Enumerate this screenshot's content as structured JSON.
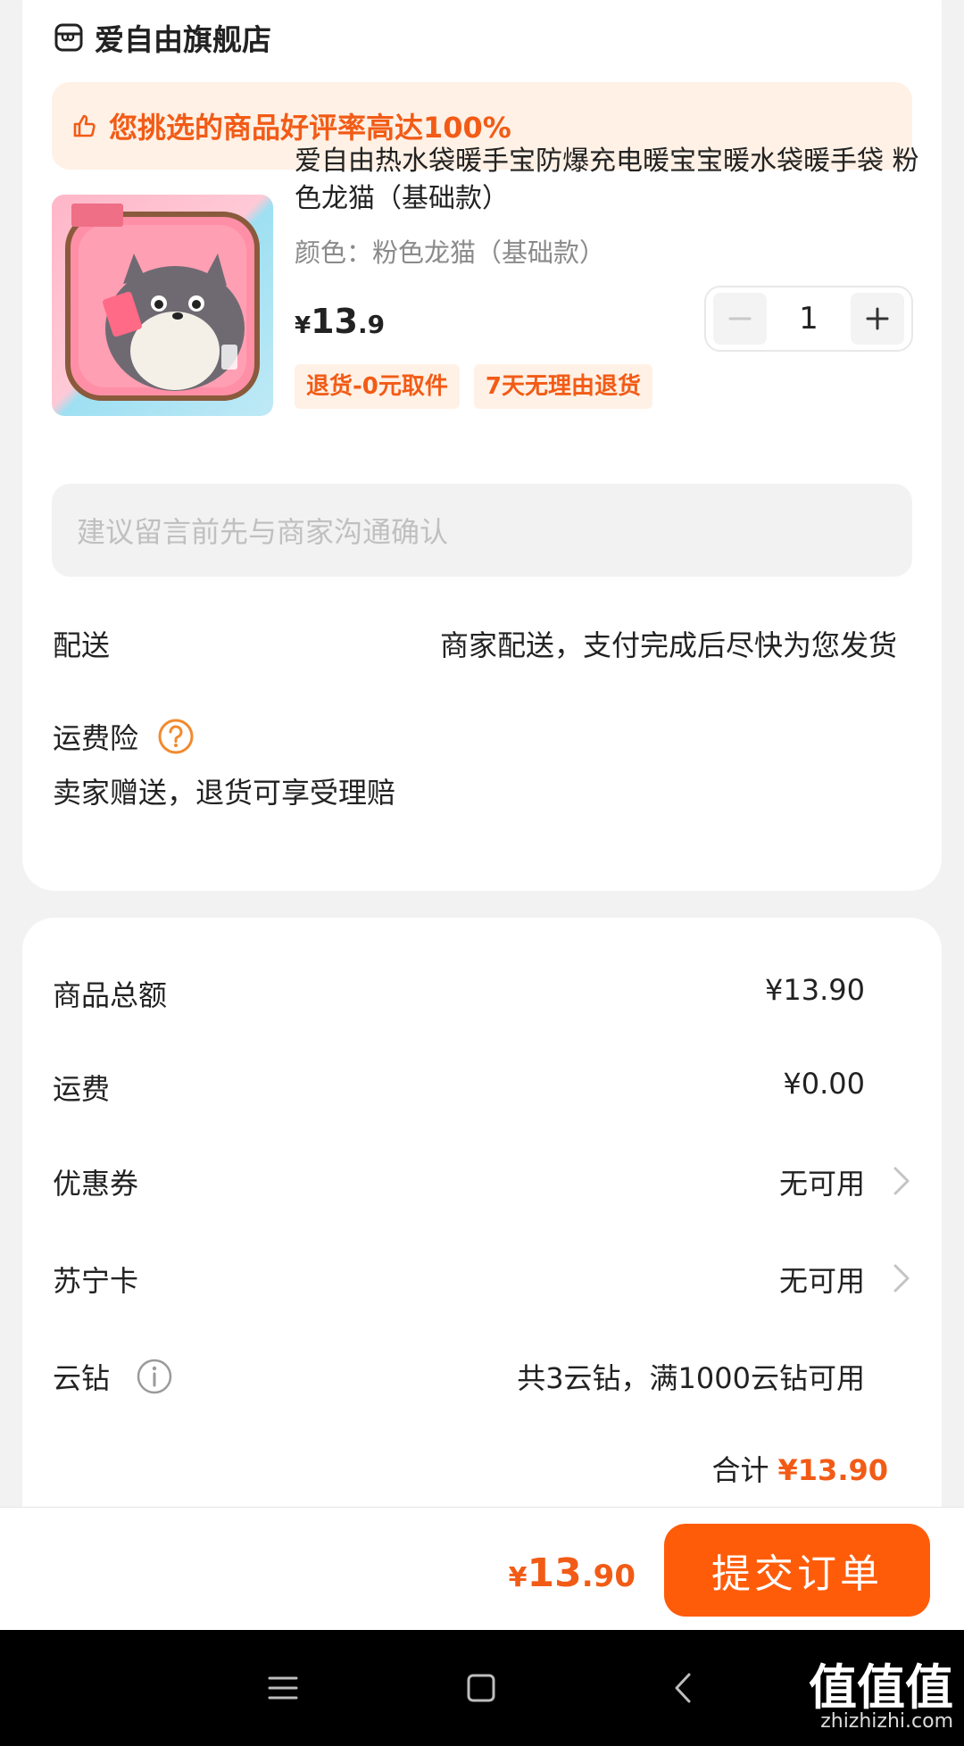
{
  "store": {
    "name": "爱自由旗舰店",
    "icon": "store-icon"
  },
  "banner": {
    "icon": "thumbs-up-icon",
    "text": "您挑选的商品好评率高达100%"
  },
  "product": {
    "image_tag": "粉色龙猫",
    "title": "爱自由热水袋暖手宝防爆充电暖宝宝暖水袋暖手袋 粉色龙猫（基础款）",
    "spec": "颜色：粉色龙猫（基础款）",
    "price_symbol": "¥",
    "price_int": "13",
    "price_dec": ".9",
    "quantity": "1",
    "tags": [
      "退货-0元取件",
      "7天无理由退货"
    ]
  },
  "note": {
    "placeholder": "建议留言前先与商家沟通确认"
  },
  "delivery": {
    "label": "配送",
    "value": "商家配送，支付完成后尽快为您发货"
  },
  "insurance": {
    "label": "运费险",
    "icon": "help-icon",
    "desc": "卖家赠送，退货可享受理赔"
  },
  "summary": {
    "rows": [
      {
        "label": "商品总额",
        "value": "¥13.90"
      },
      {
        "label": "运费",
        "value": "¥0.00"
      },
      {
        "label": "优惠券",
        "value": "无可用"
      },
      {
        "label": "苏宁卡",
        "value": "无可用"
      },
      {
        "label": "云钻",
        "value": "共3云钻，满1000云钻可用"
      }
    ],
    "total_label": "合计",
    "total_value": "¥13.90"
  },
  "footer": {
    "price_symbol": "¥",
    "price_int": "13",
    "price_dec": ".90",
    "submit_label": "提交订单"
  },
  "watermark": {
    "logo": "值值值",
    "url": "zhizhizhi.com"
  },
  "colors": {
    "accent": "#ff5c0a",
    "accent_text": "#f25b16",
    "banner_bg": "#fff1e6"
  }
}
